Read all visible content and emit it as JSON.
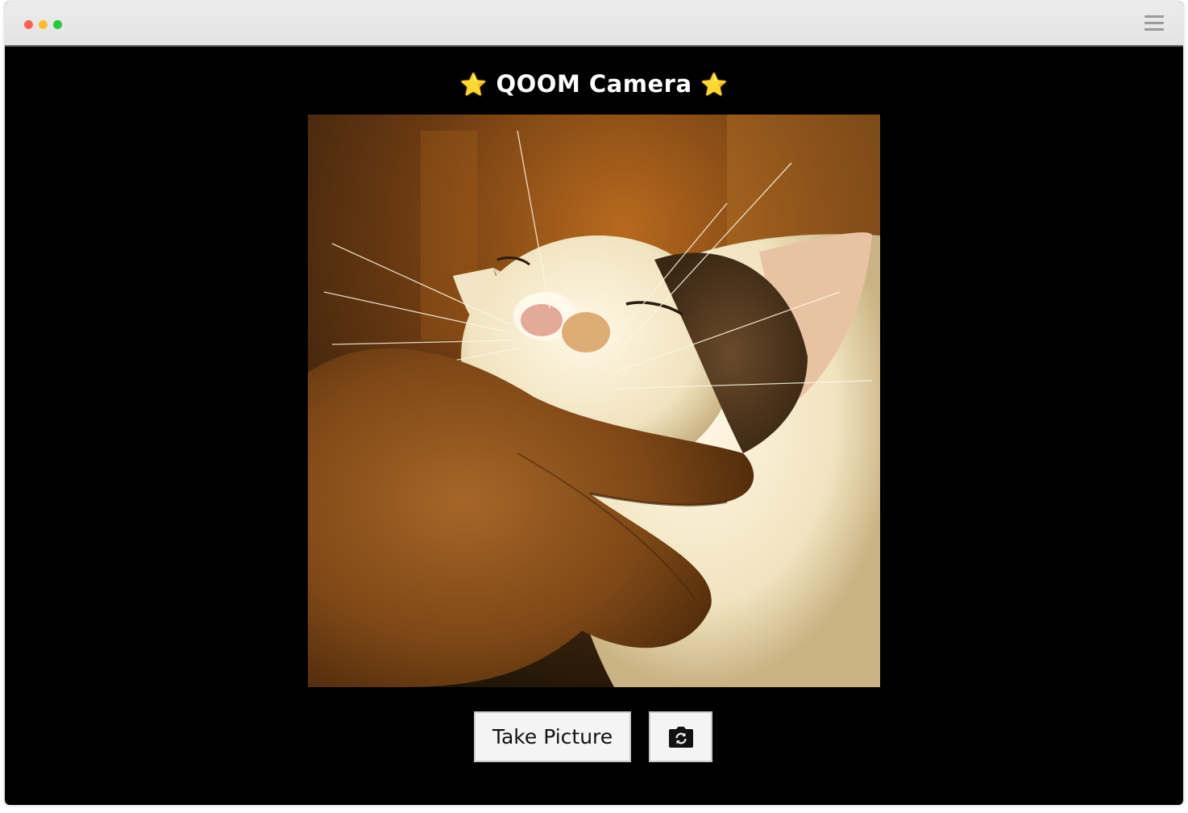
{
  "app": {
    "title_star_left": "⭐",
    "title_text": "QOOM Camera",
    "title_star_right": "⭐"
  },
  "viewfinder": {
    "subject": "cat being scratched under the chin by a hand"
  },
  "controls": {
    "take_picture_label": "Take Picture",
    "switch_camera_icon": "camera-rotate-icon"
  },
  "colors": {
    "background": "#000000",
    "title_text": "#ffffff",
    "button_bg": "#f4f4f4",
    "star": "#ffc83d"
  }
}
